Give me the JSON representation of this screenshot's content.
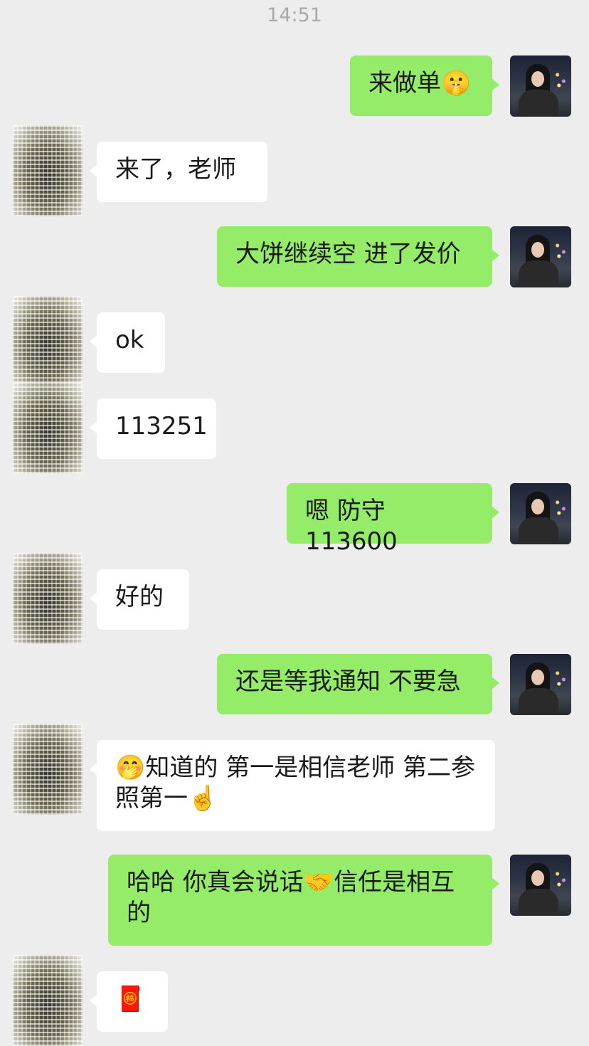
{
  "status": {
    "time": "14:51"
  },
  "messages": [
    {
      "side": "out",
      "text": "来做单",
      "emoji": "🤫"
    },
    {
      "side": "in",
      "text": "来了，老师"
    },
    {
      "side": "out",
      "text": "大饼继续空 进了发价"
    },
    {
      "side": "in",
      "text": "ok"
    },
    {
      "side": "in",
      "text": "113251"
    },
    {
      "side": "out",
      "text": "嗯 防守113600"
    },
    {
      "side": "in",
      "text": "好的"
    },
    {
      "side": "out",
      "text": "还是等我通知 不要急"
    },
    {
      "side": "in",
      "emoji_lead": "🤭",
      "text": "知道的 第一是相信老师 第二参照第一",
      "emoji": "☝️"
    },
    {
      "side": "out",
      "text_a": "哈哈 你真会说话",
      "emoji": "🤝",
      "text_b": "信任是相互的"
    },
    {
      "side": "in",
      "emoji": "🧧"
    }
  ]
}
